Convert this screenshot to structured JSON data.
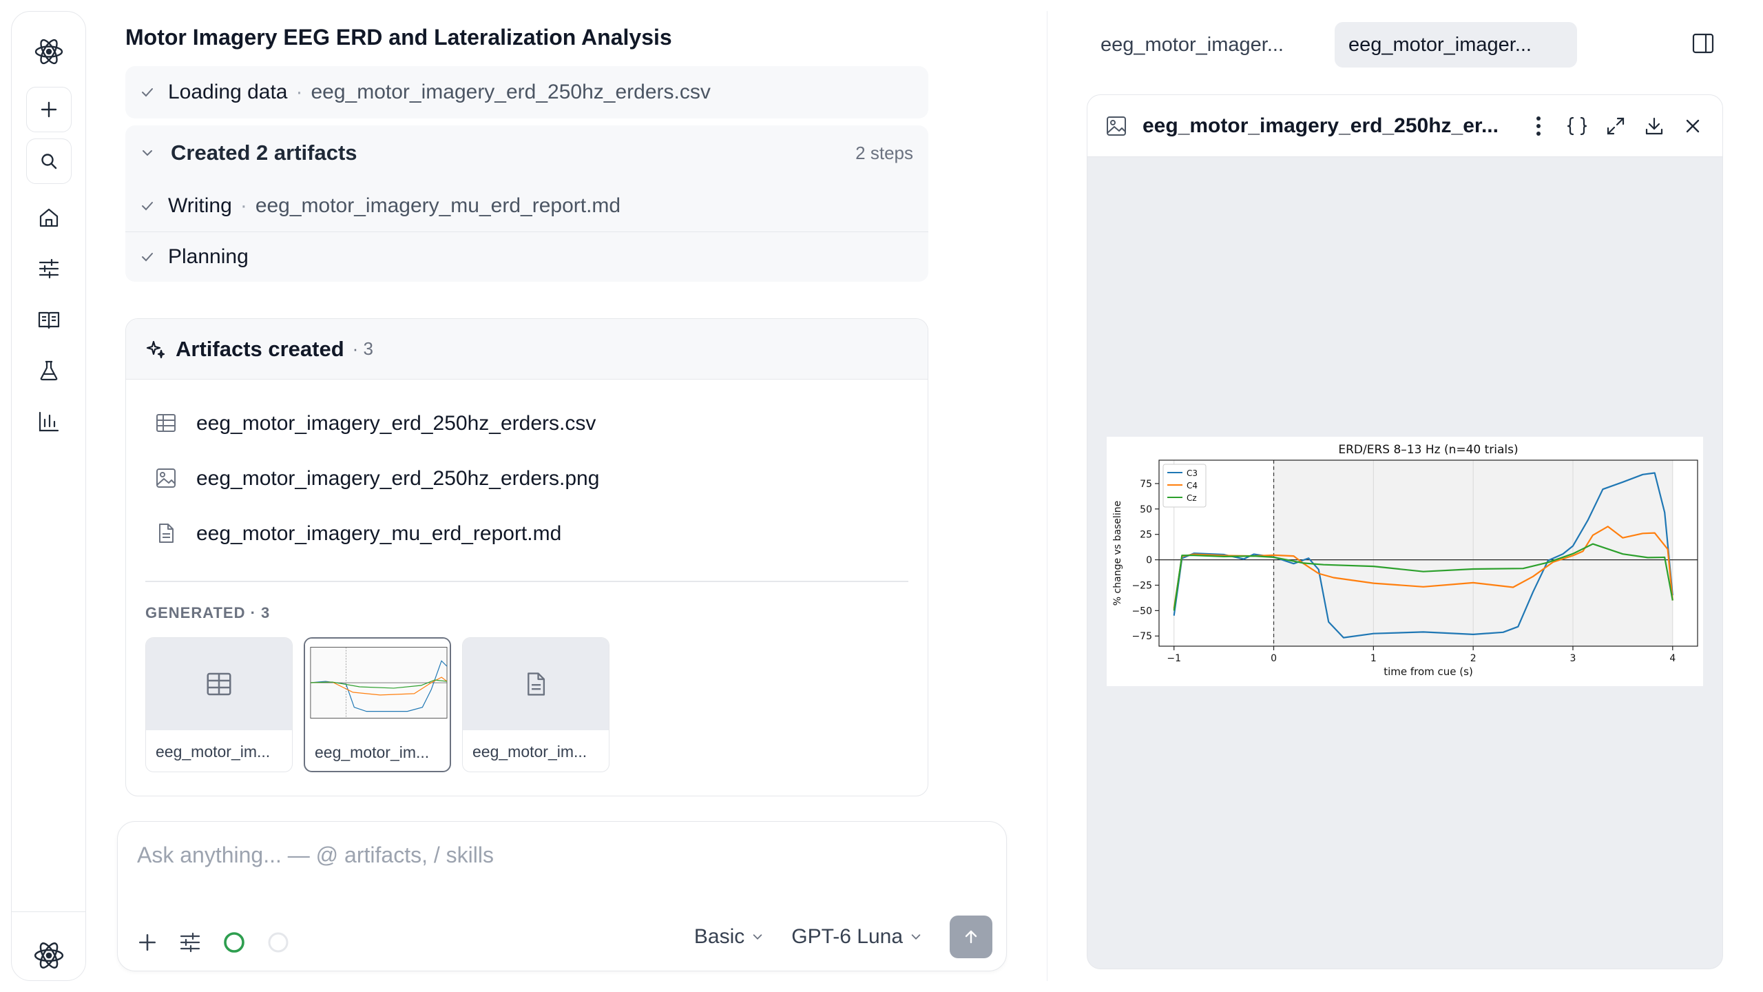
{
  "conversation": {
    "title": "Motor Imagery EEG ERD and Lateralization Analysis",
    "steps": [
      {
        "label": "Loading data",
        "detail": "eeg_motor_imagery_erd_250hz_erders.csv"
      }
    ],
    "group": {
      "label": "Created 2 artifacts",
      "count": "2 steps",
      "items": [
        {
          "label": "Writing",
          "detail": "eeg_motor_imagery_mu_erd_report.md"
        },
        {
          "label": "Planning"
        }
      ]
    },
    "artifacts_panel": {
      "title": "Artifacts created",
      "count": "· 3",
      "files": [
        {
          "name": "eeg_motor_imagery_erd_250hz_erders.csv",
          "icon": "table-icon"
        },
        {
          "name": "eeg_motor_imagery_erd_250hz_erders.png",
          "icon": "image-icon"
        },
        {
          "name": "eeg_motor_imagery_mu_erd_report.md",
          "icon": "document-icon"
        }
      ],
      "generated_label": "GENERATED · 3",
      "thumbnails": [
        {
          "caption": "eeg_motor_im..."
        },
        {
          "caption": "eeg_motor_im..."
        },
        {
          "caption": "eeg_motor_im..."
        }
      ]
    }
  },
  "composer": {
    "placeholder": "Ask anything... — @ artifacts, / skills",
    "mode": "Basic",
    "model": "GPT-6 Luna"
  },
  "right_pane": {
    "tabs": [
      {
        "label": "eeg_motor_imager..."
      },
      {
        "label": "eeg_motor_imager..."
      }
    ],
    "viewer_title": "eeg_motor_imagery_erd_250hz_er..."
  },
  "colors": {
    "C3": "#1f77b4",
    "C4": "#ff7f0e",
    "Cz": "#2ca02c",
    "status_green": "#2e9e4f"
  },
  "chart_data": {
    "type": "line",
    "title": "ERD/ERS 8–13 Hz (n=40 trials)",
    "xlabel": "time from cue (s)",
    "ylabel": "% change vs baseline",
    "xlim": [
      -1.15,
      4.25
    ],
    "ylim": [
      -85,
      98
    ],
    "xticks": [
      -1,
      0,
      1,
      2,
      3,
      4
    ],
    "yticks": [
      -75,
      -50,
      -25,
      0,
      25,
      50,
      75
    ],
    "legend": "top-left",
    "grid": true,
    "cue_line_x": 0,
    "shaded_region": [
      0,
      4
    ],
    "series": [
      {
        "name": "C3",
        "x": [
          -1,
          -0.92,
          -0.8,
          -0.5,
          -0.3,
          -0.2,
          0,
          0.2,
          0.35,
          0.45,
          0.55,
          0.7,
          1,
          1.5,
          2,
          2.3,
          2.45,
          2.6,
          2.75,
          2.9,
          3,
          3.15,
          3.3,
          3.5,
          3.7,
          3.82,
          3.92,
          4
        ],
        "y": [
          -55,
          0,
          5,
          5,
          2,
          7,
          3,
          -5,
          0,
          -10,
          -60,
          -75,
          -72,
          -72,
          -75,
          -72,
          -65,
          -30,
          0,
          5,
          12,
          38,
          70,
          78,
          85,
          85,
          45,
          -35
        ]
      },
      {
        "name": "C4",
        "x": [
          -1,
          -0.92,
          -0.8,
          -0.5,
          -0.2,
          0,
          0.2,
          0.3,
          0.45,
          0.6,
          1,
          1.5,
          2,
          2.4,
          2.6,
          2.8,
          3,
          3.1,
          3.2,
          3.35,
          3.5,
          3.7,
          3.82,
          3.95,
          4
        ],
        "y": [
          -48,
          2,
          4,
          4,
          5,
          6,
          4,
          -5,
          -15,
          -18,
          -22,
          -25,
          -22,
          -28,
          -18,
          -3,
          5,
          10,
          25,
          32,
          20,
          25,
          27,
          12,
          -40
        ]
      },
      {
        "name": "Cz",
        "x": [
          -1,
          -0.92,
          -0.8,
          -0.5,
          -0.2,
          0,
          0.3,
          0.5,
          1,
          1.5,
          2,
          2.5,
          2.75,
          3,
          3.2,
          3.5,
          3.75,
          3.92,
          4
        ],
        "y": [
          -50,
          3,
          3,
          3,
          5,
          4,
          -3,
          -6,
          -8,
          -12,
          -8,
          -7,
          -2,
          5,
          14,
          5,
          3,
          4,
          -40
        ]
      }
    ]
  }
}
